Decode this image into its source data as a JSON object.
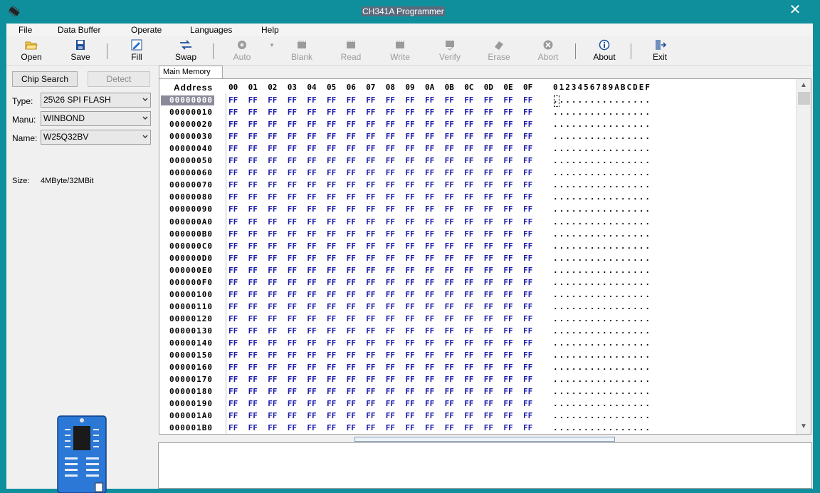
{
  "window": {
    "title": "CH341A Programmer",
    "close_icon": "close-icon"
  },
  "menu": [
    "File",
    "Data Buffer",
    "Operate",
    "Languages",
    "Help"
  ],
  "toolbar": [
    {
      "label": "Open",
      "icon": "folder-open-icon",
      "enabled": true
    },
    {
      "label": "Save",
      "icon": "floppy-disk-icon",
      "enabled": true
    },
    {
      "label": "Fill",
      "icon": "fill-icon",
      "enabled": true
    },
    {
      "label": "Swap",
      "icon": "swap-arrows-icon",
      "enabled": true
    },
    {
      "label": "Auto",
      "icon": "auto-icon",
      "enabled": false
    },
    {
      "label": "Blank",
      "icon": "chip-icon",
      "enabled": false
    },
    {
      "label": "Read",
      "icon": "chip-icon",
      "enabled": false
    },
    {
      "label": "Write",
      "icon": "chip-icon",
      "enabled": false
    },
    {
      "label": "Verify",
      "icon": "chip-icon",
      "enabled": false
    },
    {
      "label": "Erase",
      "icon": "eraser-icon",
      "enabled": false
    },
    {
      "label": "Abort",
      "icon": "abort-icon",
      "enabled": false
    },
    {
      "label": "About",
      "icon": "info-icon",
      "enabled": true
    },
    {
      "label": "Exit",
      "icon": "exit-door-icon",
      "enabled": true
    }
  ],
  "left": {
    "chip_search": "Chip Search",
    "detect": "Detect",
    "type_label": "Type:",
    "type_value": "25\\26 SPI FLASH",
    "manu_label": "Manu:",
    "manu_value": "WINBOND",
    "name_label": "Name:",
    "name_value": "W25Q32BV",
    "size_label": "Size:",
    "size_value": "4MByte/32MBit"
  },
  "hex": {
    "tab": "Main Memory",
    "address_header": "Address",
    "columns": [
      "00",
      "01",
      "02",
      "03",
      "04",
      "05",
      "06",
      "07",
      "08",
      "09",
      "0A",
      "0B",
      "0C",
      "0D",
      "0E",
      "0F"
    ],
    "ascii_header": "0123456789ABCDEF",
    "rows": [
      "00000000",
      "00000010",
      "00000020",
      "00000030",
      "00000040",
      "00000050",
      "00000060",
      "00000070",
      "00000080",
      "00000090",
      "000000A0",
      "000000B0",
      "000000C0",
      "000000D0",
      "000000E0",
      "000000F0",
      "00000100",
      "00000110",
      "00000120",
      "00000130",
      "00000140",
      "00000150",
      "00000160",
      "00000170",
      "00000180",
      "00000190",
      "000001A0",
      "000001B0"
    ],
    "cell_value": "FF",
    "ascii_value": "................"
  },
  "colors": {
    "accent": "#0f8f9c",
    "hex_text": "#1a1aaa"
  }
}
